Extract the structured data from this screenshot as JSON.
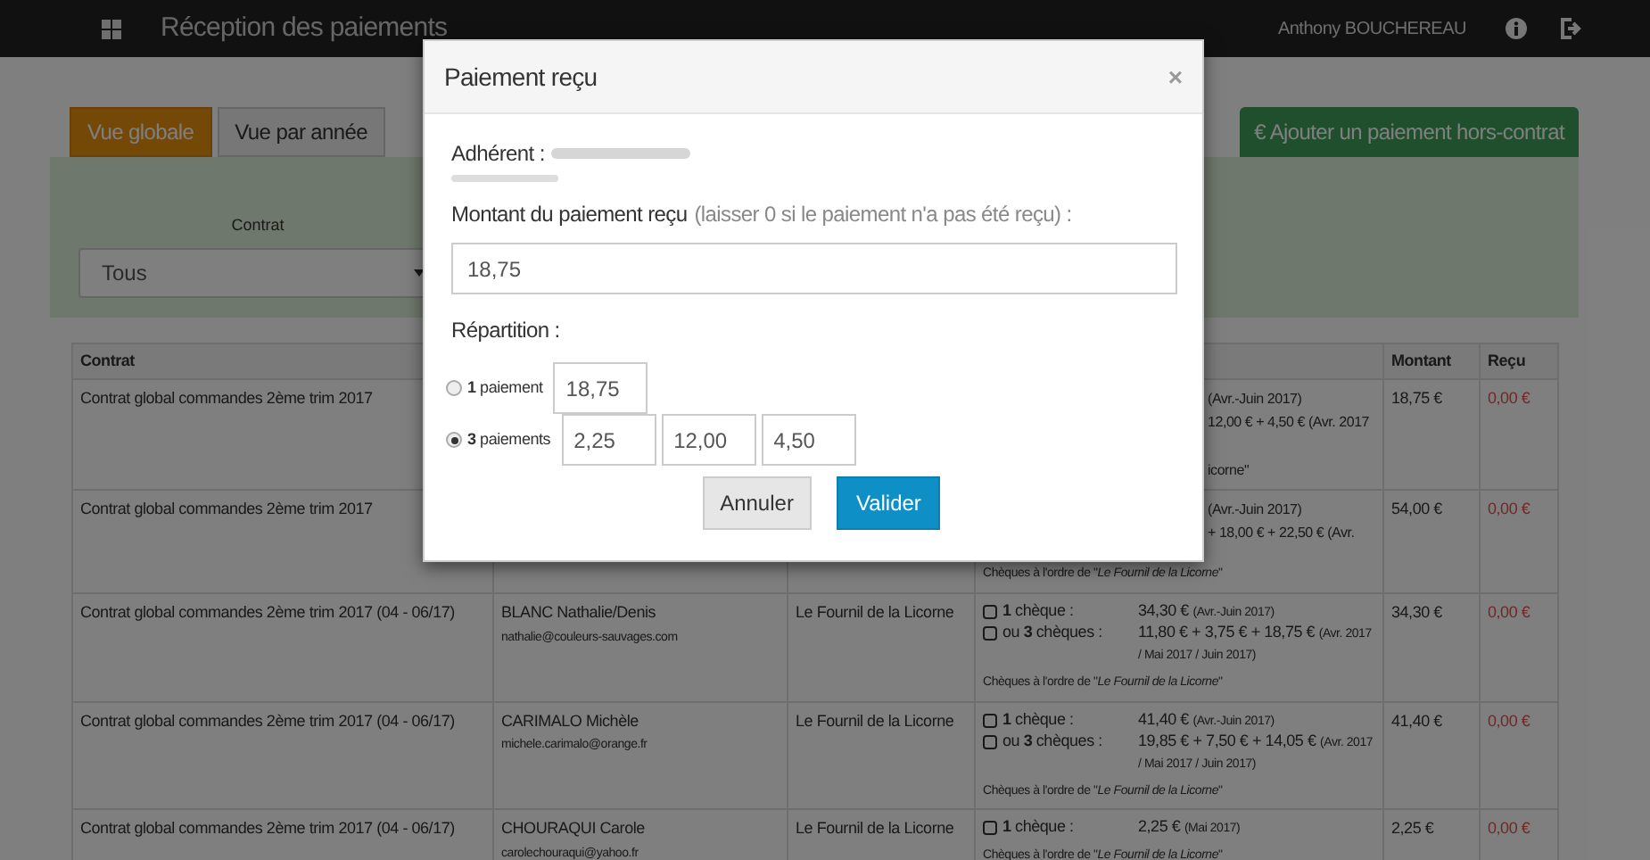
{
  "navbar": {
    "title": "Réception des paiements",
    "user": "Anthony BOUCHEREAU"
  },
  "tabs": [
    {
      "label": "Vue globale",
      "selected": true
    },
    {
      "label": "Vue par année",
      "selected": false
    }
  ],
  "add_button": "€ Ajouter un paiement hors-contrat",
  "filter": {
    "label": "Contrat",
    "value": "Tous"
  },
  "table": {
    "columns": [
      "Contrat",
      "Montant",
      "Reçu"
    ],
    "rows": [
      {
        "kind": "covered",
        "contract": "Contrat global commandes 2ème trim 2017",
        "fragments": [
          "(Avr.-Juin 2017)",
          "12,00 € + 4,50 € (Avr. 2017",
          "icorne\""
        ],
        "amount": "18,75 €",
        "received": "0,00 €"
      },
      {
        "kind": "covered",
        "contract": "Contrat global commandes 2ème trim 2017",
        "fragments": [
          "(Avr.-Juin 2017)",
          "+ 18,00 € + 22,50 € (Avr."
        ],
        "note": "Chèques à l'ordre de \"*Le Fournil de la Licorne*\"",
        "amount": "54,00 €",
        "received": "0,00 €"
      },
      {
        "kind": "full",
        "contract": "Contrat global commandes 2ème trim 2017 (04 - 06/17)",
        "member": "BLANC Nathalie/Denis",
        "email": "nathalie@couleurs-sauvages.com",
        "producer": "Le Fournil de la Licorne",
        "options": [
          {
            "label": "**1** chèque :",
            "amount": "34,30 €",
            "period": "(Avr.-Juin 2017)",
            "checked": false
          },
          {
            "label": "ou **3** chèques :",
            "amount": "11,80 € + 3,75 € + 18,75 €",
            "period": "(Avr. 2017 / Mai 2017 / Juin 2017)",
            "checked": false
          }
        ],
        "note": "Chèques à l'ordre de \"*Le Fournil de la Licorne*\"",
        "amount": "34,30 €",
        "received": "0,00 €"
      },
      {
        "kind": "full",
        "contract": "Contrat global commandes 2ème trim 2017 (04 - 06/17)",
        "member": "CARIMALO Michèle",
        "email": "michele.carimalo@orange.fr",
        "producer": "Le Fournil de la Licorne",
        "options": [
          {
            "label": "**1** chèque :",
            "amount": "41,40 €",
            "period": "(Avr.-Juin 2017)",
            "checked": false
          },
          {
            "label": "ou **3** chèques :",
            "amount": "19,85 € + 7,50 € + 14,05 €",
            "period": "(Avr. 2017 / Mai 2017 / Juin 2017)",
            "checked": false
          }
        ],
        "note": "Chèques à l'ordre de \"*Le Fournil de la Licorne*\"",
        "amount": "41,40 €",
        "received": "0,00 €"
      },
      {
        "kind": "full",
        "contract": "Contrat global commandes 2ème trim 2017 (04 - 06/17)",
        "member": "CHOURAQUI Carole",
        "email": "carolechouraqui@yahoo.fr",
        "producer": "Le Fournil de la Licorne",
        "options": [
          {
            "label": "**1** chèque :",
            "amount": "2,25 €",
            "period": "(Mai 2017)",
            "checked": false
          }
        ],
        "note": "Chèques à l'ordre de \"*Le Fournil de la Licorne*\"",
        "amount": "2,25 €",
        "received": "0,00 €"
      }
    ]
  },
  "modal": {
    "title": "Paiement reçu",
    "close": "×",
    "member_label": "Adhérent :",
    "amount_label": "Montant du paiement reçu",
    "amount_hint": "(laisser 0 si le paiement n'a pas été reçu) :",
    "amount_value": "18,75",
    "split_label": "Répartition :",
    "options": [
      {
        "label": "**1** paiement",
        "selected": false,
        "values": [
          "18,75"
        ]
      },
      {
        "label": "**3** paiements",
        "selected": true,
        "values": [
          "2,25",
          "12,00",
          "4,50"
        ]
      }
    ],
    "buttons": [
      {
        "kind": "cancel",
        "label": "Annuler"
      },
      {
        "kind": "primary",
        "label": "Valider"
      }
    ]
  }
}
